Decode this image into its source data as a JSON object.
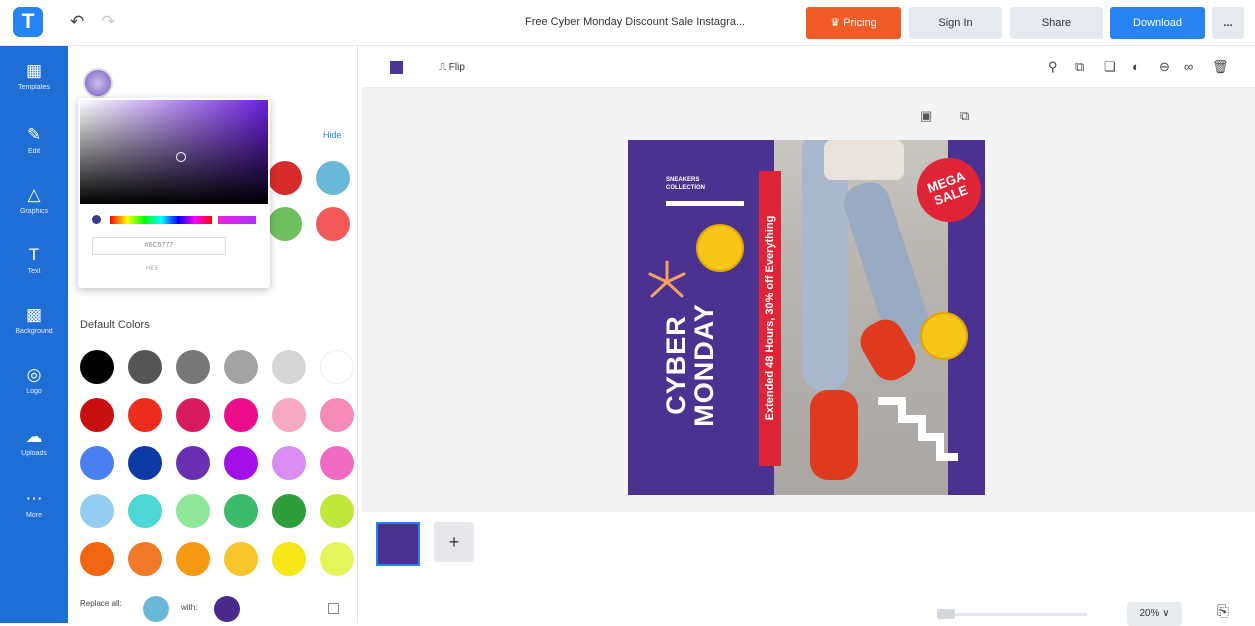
{
  "topbar": {
    "logo": "T",
    "doc_title": "Free Cyber Monday Discount Sale Instagra...",
    "pricing": "Pricing",
    "sign_in": "Sign In",
    "share": "Share",
    "download": "Download",
    "more": "..."
  },
  "sidebar": {
    "items": [
      {
        "label": "Templates",
        "icon": "grid-icon"
      },
      {
        "label": "Edit",
        "icon": "pen-icon"
      },
      {
        "label": "Graphics",
        "icon": "shapes-icon"
      },
      {
        "label": "Text",
        "icon": "text-icon"
      },
      {
        "label": "Background",
        "icon": "pattern-icon"
      },
      {
        "label": "Logo",
        "icon": "logo-icon"
      },
      {
        "label": "Uploads",
        "icon": "cloud-upload-icon"
      },
      {
        "label": "More",
        "icon": "more-icon"
      }
    ]
  },
  "panel": {
    "hide_label": "Hide",
    "picker": {
      "hex_value": "#6C5777",
      "hex_label": "HEX"
    },
    "default_colors_title": "Default Colors",
    "document_colors": [
      "#d72a2a",
      "#6ab8d8",
      "#6fbf5f",
      "#f25a5a"
    ],
    "default_colors": [
      "#000000",
      "#555555",
      "#777777",
      "#a3a3a3",
      "#d6d6d6",
      "#ffffff",
      "#c80f0f",
      "#ee2c1d",
      "#d81b60",
      "#ec0d8a",
      "#f7a8c3",
      "#f58ab8",
      "#4a7ff0",
      "#0b3aa5",
      "#6b2fb1",
      "#a40fe8",
      "#d98cf2",
      "#f16ac3",
      "#93cef2",
      "#4fd6d6",
      "#8fe89a",
      "#3cbb6b",
      "#2e9e3a",
      "#bfe83a",
      "#f0650f",
      "#f07a25",
      "#f59a12",
      "#f7c52a",
      "#f7e615",
      "#e6f55a"
    ],
    "replace_all_label": "Replace all:",
    "with_label": "with:"
  },
  "workspace": {
    "flip_label": "Flip",
    "zoom": "20%",
    "zoom_caret": "∨"
  },
  "design": {
    "sneakers_line1": "SNEAKERS",
    "sneakers_line2": "COLLECTION",
    "strip_text": "Extended 48 Hours, 30% off Everything",
    "cyber": "CYBER",
    "monday": "MONDAY",
    "mega_line1": "MEGA",
    "mega_line2": "SALE"
  }
}
